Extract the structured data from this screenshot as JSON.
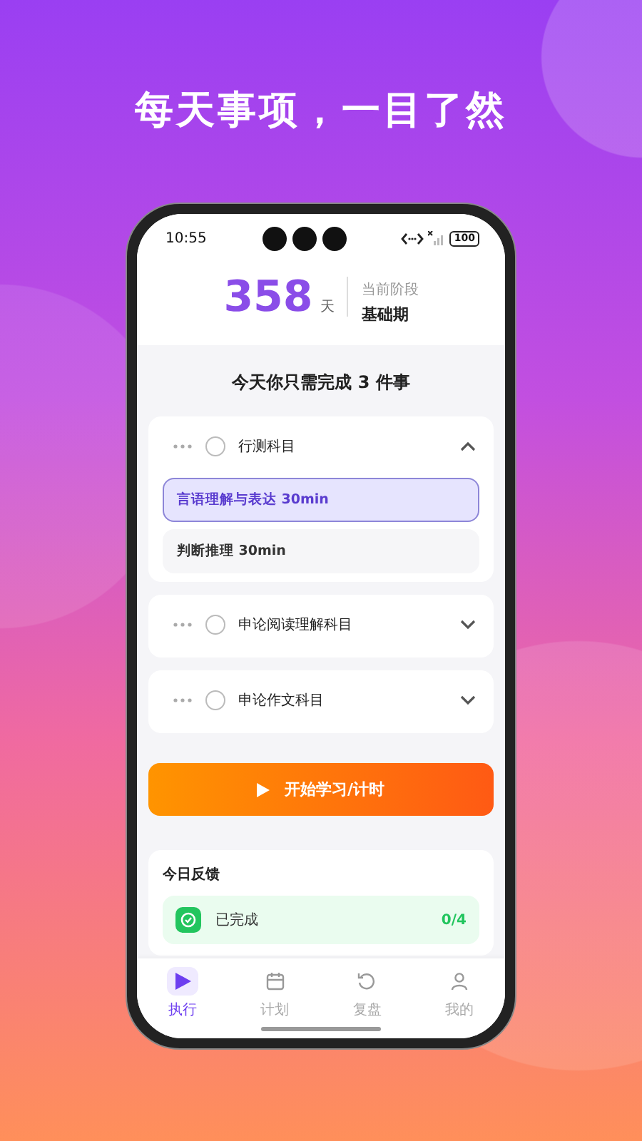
{
  "headline": "每天事项，一目了然",
  "status_bar": {
    "time": "10:55",
    "battery": "100"
  },
  "countdown": {
    "number": "358",
    "unit": "天",
    "stage_label": "当前阶段",
    "stage": "基础期"
  },
  "today_title": "今天你只需完成 **3** 件事",
  "tasks": [
    {
      "name": "行测科目",
      "checked": false,
      "expanded": true,
      "subtasks": [
        {
          "label": "言语理解与表达 30min",
          "selected": true
        },
        {
          "label": "判断推理 30min",
          "selected": false
        }
      ]
    },
    {
      "name": "申论阅读理解科目",
      "checked": false,
      "expanded": false
    },
    {
      "name": "申论作文科目",
      "checked": false,
      "expanded": false
    }
  ],
  "start_button": "开始学习/计时",
  "feedback": {
    "title": "今日反馈",
    "rows": [
      {
        "label": "已完成",
        "value": "0/4",
        "color": "#22c55e"
      }
    ]
  },
  "tabs": [
    {
      "label": "执行",
      "kind": "play",
      "selected": true
    },
    {
      "label": "计划",
      "kind": "calendar",
      "selected": false
    },
    {
      "label": "复盘",
      "kind": "review",
      "selected": false
    },
    {
      "label": "我的",
      "kind": "person",
      "selected": false
    }
  ]
}
